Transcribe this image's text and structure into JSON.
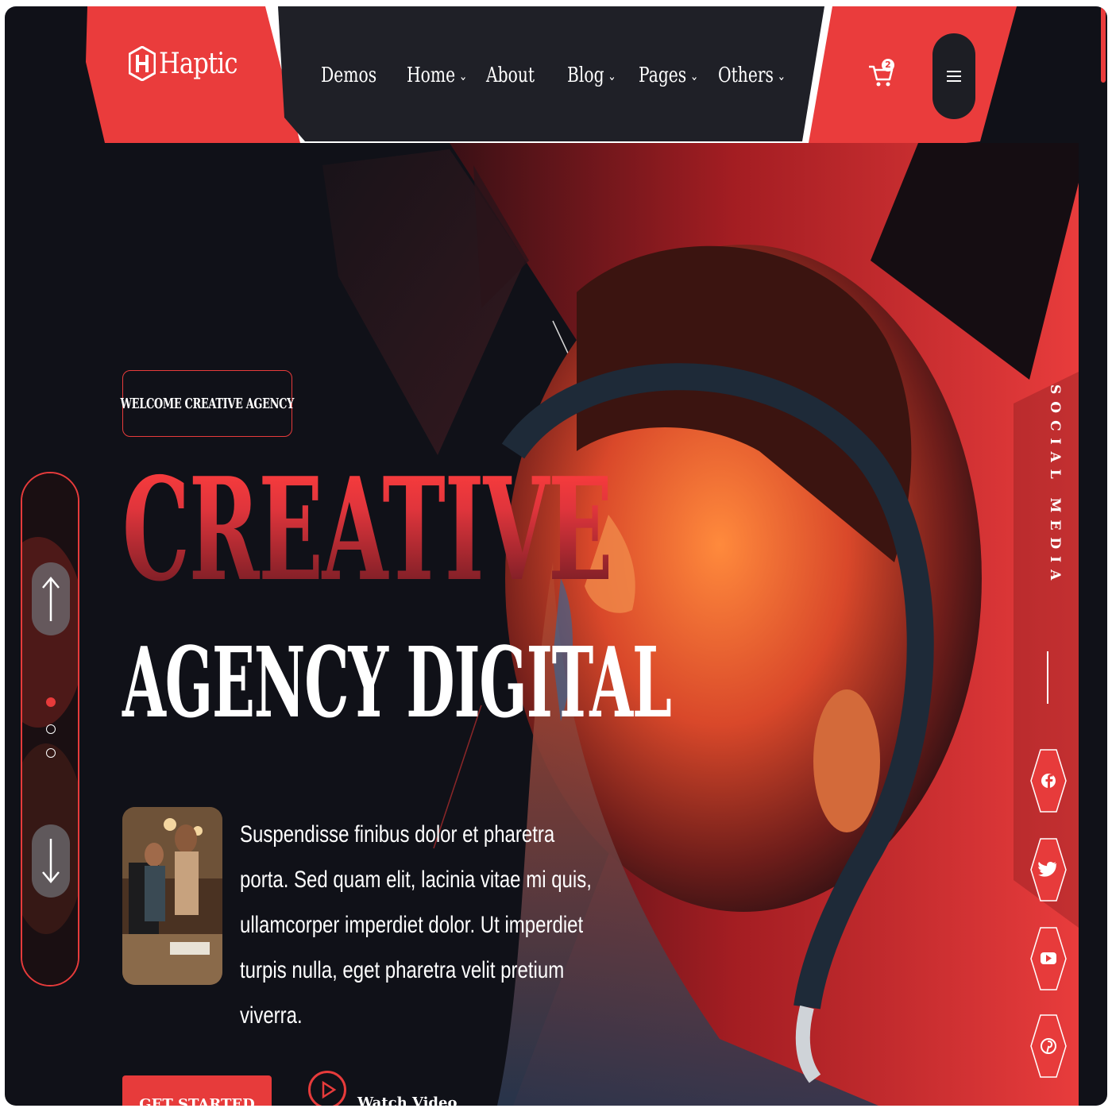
{
  "brand": {
    "name": "Haptic"
  },
  "nav": {
    "items": [
      {
        "label": "Demos",
        "has_dropdown": false
      },
      {
        "label": "Home",
        "has_dropdown": true
      },
      {
        "label": "About",
        "has_dropdown": false
      },
      {
        "label": "Blog",
        "has_dropdown": true
      },
      {
        "label": "Pages",
        "has_dropdown": true
      },
      {
        "label": "Others",
        "has_dropdown": true
      }
    ],
    "dropdown_icon": "chevron-down-icon"
  },
  "cart": {
    "count": "2",
    "icon": "cart-icon"
  },
  "menu": {
    "icon": "hamburger-icon"
  },
  "hero": {
    "badge": "WELCOME CREATIVE AGENCY",
    "title_line1": "CREATIVE",
    "title_line2": "AGENCY DIGITAL",
    "description": "Suspendisse finibus dolor et pharetra porta. Sed quam elit, lacinia vitae mi quis, ullamcorper imperdiet dolor. Ut imperdiet turpis nulla, eget pharetra velit pretium viverra.",
    "cta_label": "GET STARTED",
    "video_label": "Watch Video"
  },
  "slider": {
    "total_slides": 3,
    "active_slide": 1
  },
  "social": {
    "label": "SOCIAL MEDIA",
    "links": [
      {
        "name": "facebook",
        "icon": "facebook-icon"
      },
      {
        "name": "twitter",
        "icon": "twitter-icon"
      },
      {
        "name": "youtube",
        "icon": "youtube-icon"
      },
      {
        "name": "pinterest",
        "icon": "pinterest-icon"
      }
    ]
  },
  "colors": {
    "accent": "#e73b3b",
    "dark": "#101118",
    "nav_bg": "#1f2027"
  }
}
